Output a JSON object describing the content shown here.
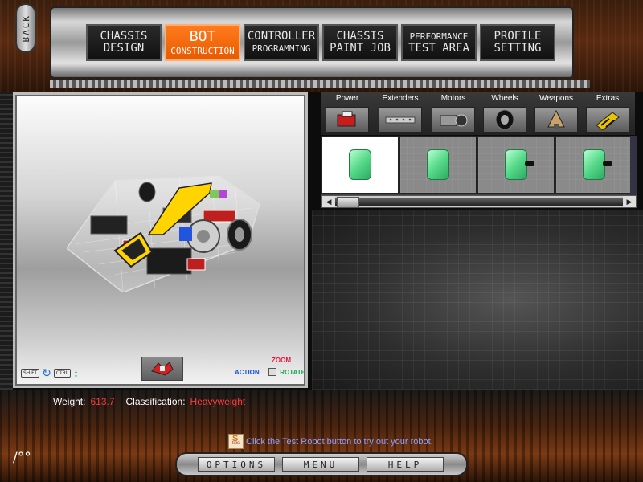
{
  "back": {
    "label": "BACK"
  },
  "nav": {
    "tabs": [
      {
        "line1": "CHASSIS",
        "line2": "DESIGN",
        "active": false
      },
      {
        "line1": "BOT",
        "line2": "CONSTRUCTION",
        "active": true
      },
      {
        "line1": "CONTROLLER",
        "line2": "PROGRAMMING",
        "active": false
      },
      {
        "line1": "CHASSIS",
        "line2": "PAINT JOB",
        "active": false
      },
      {
        "line1": "PERFORMANCE",
        "line2": "TEST AREA",
        "active": false
      },
      {
        "line1": "PROFILE",
        "line2": "SETTING",
        "active": false
      }
    ]
  },
  "viewport": {
    "shift_key": "SHIFT",
    "ctrl_key": "CTRL",
    "legend": {
      "zoom": "ZOOM",
      "action": "ACTION",
      "rotate": "ROTATE"
    }
  },
  "stats": {
    "weight_label": "Weight:",
    "weight_value": "613.7",
    "class_label": "Classification:",
    "class_value": "Heavyweight"
  },
  "categories": [
    {
      "label": "Power",
      "icon": "battery-icon"
    },
    {
      "label": "Extenders",
      "icon": "extender-bar-icon"
    },
    {
      "label": "Motors",
      "icon": "motor-icon"
    },
    {
      "label": "Wheels",
      "icon": "wheel-icon"
    },
    {
      "label": "Weapons",
      "icon": "weapon-icon"
    },
    {
      "label": "Extras",
      "icon": "extras-icon"
    }
  ],
  "parts": [
    {
      "icon": "battery-icon",
      "selected": true,
      "plug": false
    },
    {
      "icon": "battery-icon",
      "selected": false,
      "plug": false
    },
    {
      "icon": "battery-icon",
      "selected": false,
      "plug": true
    },
    {
      "icon": "battery-icon",
      "selected": false,
      "plug": true
    }
  ],
  "tip": {
    "text": "Click the Test Robot button to try out your robot."
  },
  "menu": {
    "options": "OPTIONS",
    "menu": "MENU",
    "help": "HELP"
  }
}
